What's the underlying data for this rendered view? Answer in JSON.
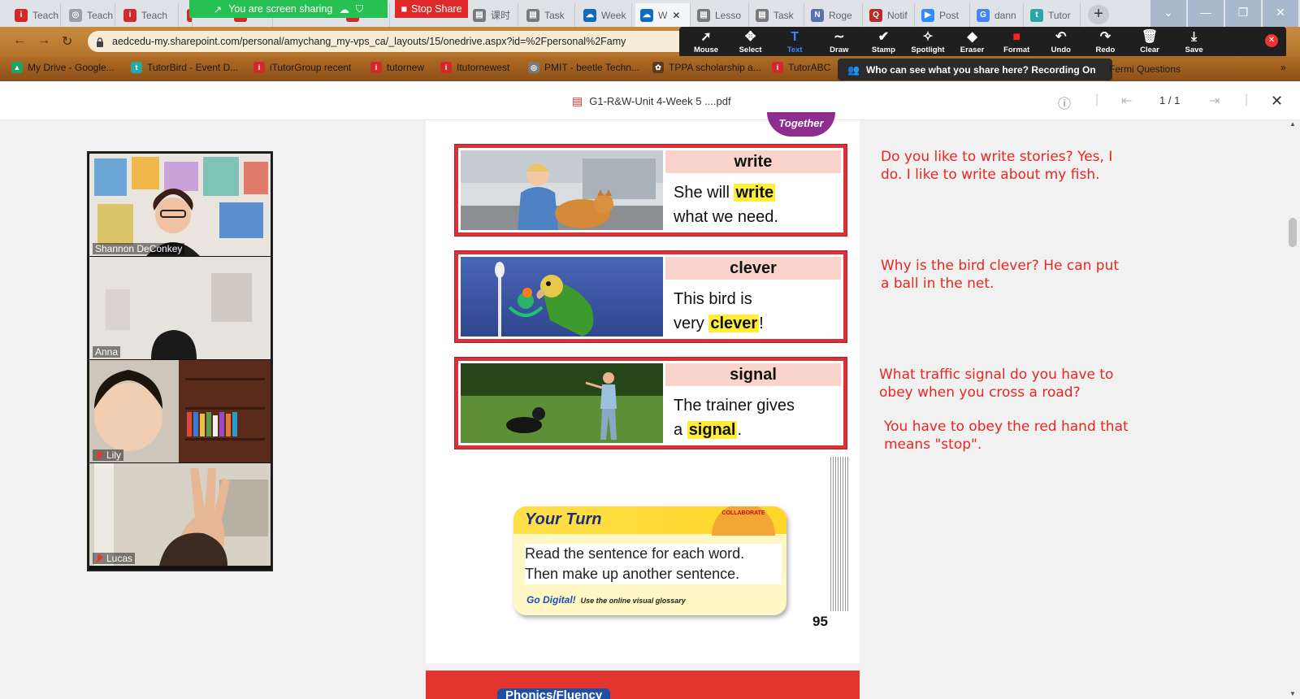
{
  "browser": {
    "tabs": [
      {
        "label": "Teach",
        "icon": "itutor-icon",
        "color": "#d22828"
      },
      {
        "label": "Teach",
        "icon": "generic-globe-icon",
        "color": "#9aa0a6"
      },
      {
        "label": "Teach",
        "icon": "itutor-icon",
        "color": "#d22828"
      },
      {
        "label": "",
        "icon": "itutor-icon",
        "color": "#d22828"
      },
      {
        "label": "",
        "icon": "itutor-icon",
        "color": "#d22828"
      },
      {
        "label": "",
        "icon": "itutor-icon",
        "color": "#d22828"
      },
      {
        "label": "课时",
        "icon": "doc-icon",
        "color": "#7a7a7a"
      },
      {
        "label": "Task",
        "icon": "doc-icon",
        "color": "#7a7a7a"
      },
      {
        "label": "Week",
        "icon": "onedrive-icon",
        "color": "#0f6cbd"
      },
      {
        "label": "W",
        "icon": "onedrive-icon",
        "color": "#0f6cbd",
        "active": true
      },
      {
        "label": "Lesso",
        "icon": "doc-icon",
        "color": "#7a7a7a"
      },
      {
        "label": "Task",
        "icon": "doc-icon",
        "color": "#7a7a7a"
      },
      {
        "label": "Roge",
        "icon": "news-icon",
        "color": "#5b6fb5"
      },
      {
        "label": "Notif",
        "icon": "quora-icon",
        "color": "#b92b27"
      },
      {
        "label": "Post",
        "icon": "zoom-icon",
        "color": "#2d8cff"
      },
      {
        "label": "dann",
        "icon": "google-icon",
        "color": "#4285f4"
      },
      {
        "label": "Tutor",
        "icon": "tutorbird-icon",
        "color": "#27a8a3"
      }
    ],
    "url": "aedcedu-my.sharepoint.com/personal/amychang_my-vps_ca/_layouts/15/onedrive.aspx?id=%2Fpersonal%2Famy",
    "bookmarks": [
      {
        "label": "My Drive - Google...",
        "icon": "google-drive-icon",
        "color": "#1fa463"
      },
      {
        "label": "TutorBird - Event D...",
        "icon": "tutorbird-icon",
        "color": "#27a8a3"
      },
      {
        "label": "iTutorGroup recent",
        "icon": "itutor-icon",
        "color": "#d22828"
      },
      {
        "label": "tutornew",
        "icon": "itutor-icon",
        "color": "#d22828"
      },
      {
        "label": "Itutornewest",
        "icon": "itutor-icon",
        "color": "#d22828"
      },
      {
        "label": "PMIT - beetle Techn...",
        "icon": "generic-globe-icon",
        "color": "#7a7a7a"
      },
      {
        "label": "TPPA scholarship a...",
        "icon": "tppa-icon",
        "color": "#5a3a1a"
      },
      {
        "label": "TutorABC",
        "icon": "itutor-icon",
        "color": "#d22828"
      }
    ],
    "overflow_bookmark": "Fermi Questions"
  },
  "zoom": {
    "share_banner": "You are screen sharing",
    "stop_share": "Stop Share",
    "annotation_tools": [
      {
        "label": "Mouse",
        "icon": "cursor-icon"
      },
      {
        "label": "Select",
        "icon": "move-icon"
      },
      {
        "label": "Text",
        "icon": "text-icon",
        "selected": true
      },
      {
        "label": "Draw",
        "icon": "draw-icon"
      },
      {
        "label": "Stamp",
        "icon": "stamp-icon"
      },
      {
        "label": "Spotlight",
        "icon": "spotlight-icon"
      },
      {
        "label": "Eraser",
        "icon": "eraser-icon"
      },
      {
        "label": "Format",
        "icon": "format-icon"
      },
      {
        "label": "Undo",
        "icon": "undo-icon"
      },
      {
        "label": "Redo",
        "icon": "redo-icon"
      },
      {
        "label": "Clear",
        "icon": "trash-icon"
      },
      {
        "label": "Save",
        "icon": "save-icon"
      }
    ],
    "recording_notice": "Who can see what you share here? Recording On",
    "format_color": "#ff2020"
  },
  "pdf": {
    "filename": "G1-R&W-Unit 4-Week 5 ....pdf",
    "page_indicator": "1 / 1",
    "badge": "Together",
    "cards": [
      {
        "word": "write",
        "sentence_before": "She will ",
        "highlight": "write",
        "sentence_after": " what we need.",
        "line1": "She will ",
        "line2_pre": "what we need.",
        "photo": "vet-with-cat"
      },
      {
        "word": "clever",
        "sentence_line1": "This bird is",
        "line2_pre": "very ",
        "highlight": "clever",
        "line2_post": "!",
        "photo": "parrot-with-ball"
      },
      {
        "word": "signal",
        "sentence_line1": "The trainer gives",
        "line2_pre": "a ",
        "highlight": "signal",
        "line2_post": ".",
        "photo": "trainer-with-dog"
      }
    ],
    "your_turn": {
      "title": "Your Turn",
      "badge": "COLLABORATE",
      "body_line1": "Read the sentence for each word.",
      "body_line2": "Then make up another sentence.",
      "go_digital": "Go Digital!",
      "go_digital_sub": "Use the online visual glossary"
    },
    "page_number": "95",
    "next_page_heading": "Phonics/Fluency"
  },
  "notes": [
    "Do you like to write stories?  Yes, I\ndo.  I like to write about my fish.",
    "Why is the bird clever?  He can put\na ball in the net.",
    "What traffic signal do you have to\nobey when you cross a road?",
    "You have to obey the red hand that\nmeans \"stop\"."
  ],
  "participants": [
    {
      "name": "Shannon DeConkey",
      "muted": false
    },
    {
      "name": "Anna",
      "muted": false,
      "speaking": true
    },
    {
      "name": "Lily",
      "muted": true
    },
    {
      "name": "Lucas",
      "muted": true
    }
  ]
}
